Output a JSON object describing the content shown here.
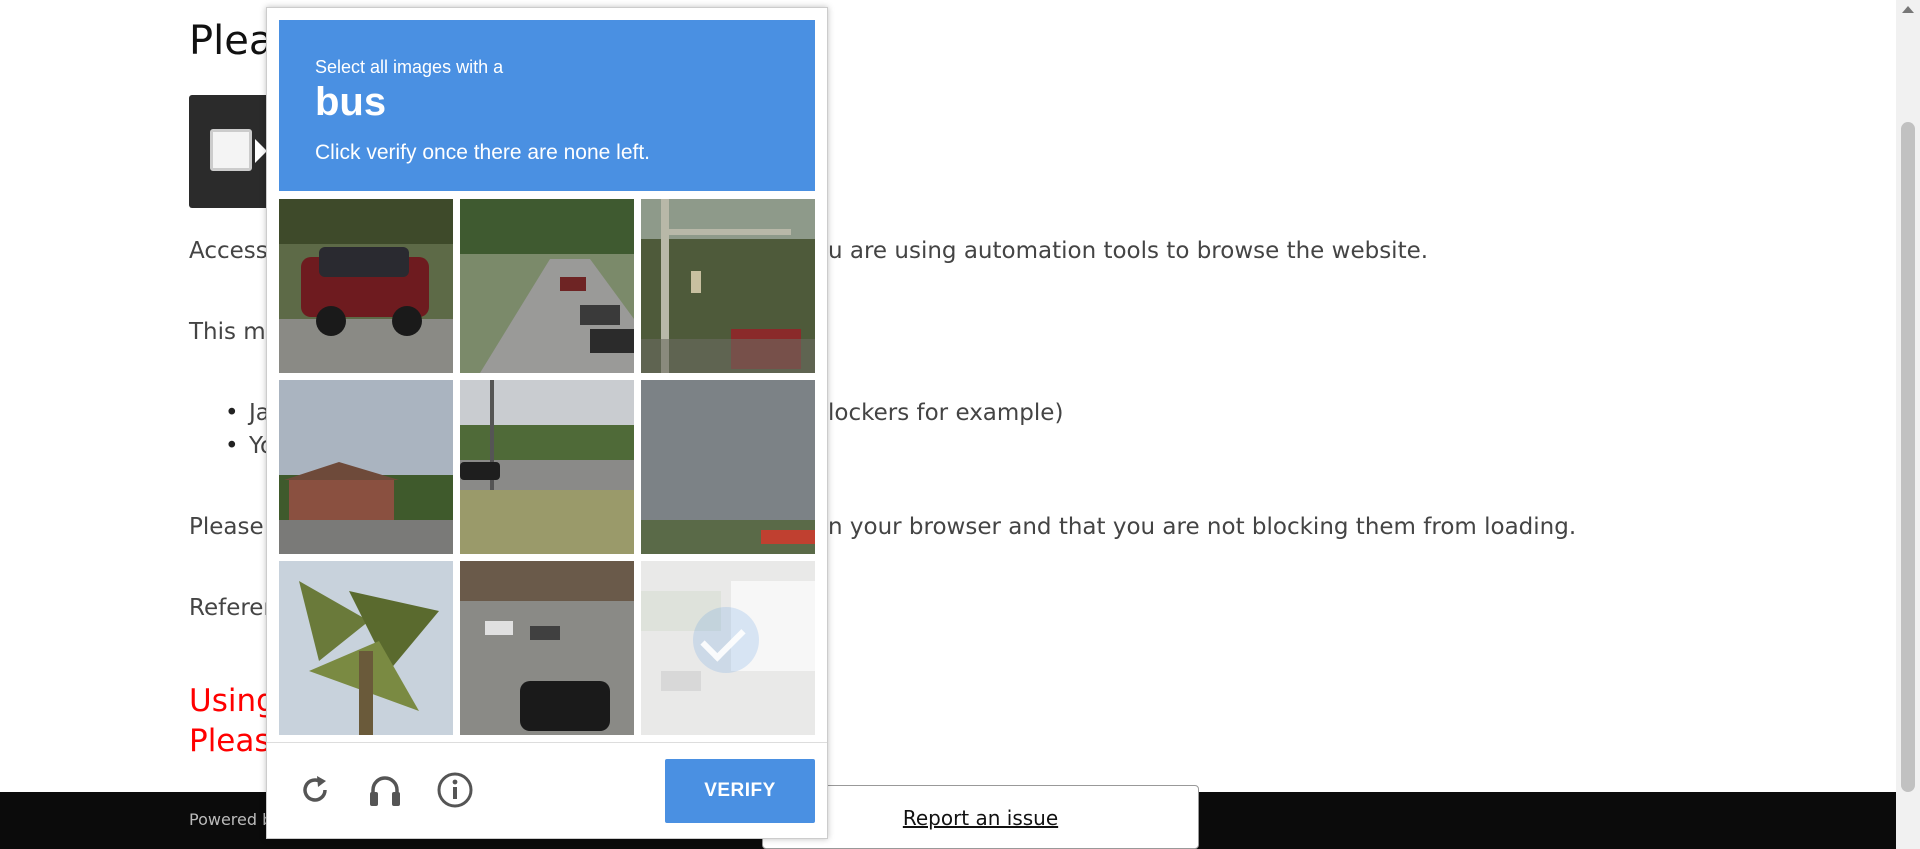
{
  "page": {
    "title": "Pleas",
    "para1": "Access",
    "para1_right": "u are using automation tools to browse the website.",
    "para2": "This ma",
    "bullet1": "Ja",
    "bullet1_right": "lockers for example)",
    "bullet2": "Yo",
    "para3": "Please",
    "para3_right": "n your browser and that you are not blocking them from loading.",
    "para4": "Referer",
    "red1": "Using",
    "red2": "Please",
    "footer_text": "Powered b",
    "report_link": "Report an issue"
  },
  "captcha": {
    "instruction": "Select all images with a",
    "target_object": "bus",
    "subtext": "Click verify once there are none left.",
    "tiles": [
      {
        "label": "car on street",
        "selected": false
      },
      {
        "label": "road with parked cars",
        "selected": false
      },
      {
        "label": "street with traffic light",
        "selected": false
      },
      {
        "label": "building with trees",
        "selected": false
      },
      {
        "label": "road with grass field",
        "selected": false
      },
      {
        "label": "cloudy sky over road",
        "selected": false
      },
      {
        "label": "palm tree",
        "selected": false
      },
      {
        "label": "intersection with cars",
        "selected": false
      },
      {
        "label": "bus near street",
        "selected": true
      }
    ],
    "reload_icon": "reload-icon",
    "audio_icon": "headphones-icon",
    "info_icon": "info-icon",
    "verify_label": "VERIFY"
  },
  "colors": {
    "accent": "#4a90e2",
    "error_text": "#ff0000",
    "footer_bg": "#0b0b0b"
  }
}
